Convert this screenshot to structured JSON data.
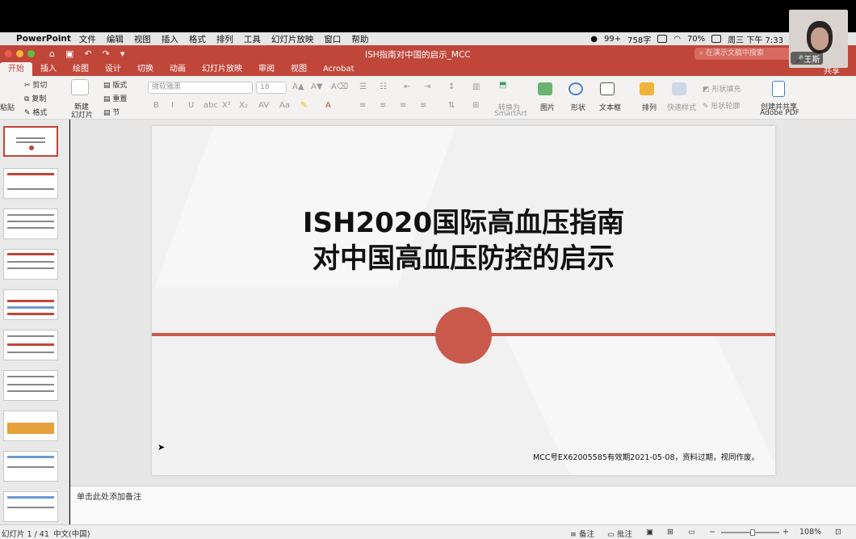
{
  "menubar": {
    "app": "PowerPoint",
    "items": [
      "文件",
      "编辑",
      "视图",
      "插入",
      "格式",
      "排列",
      "工具",
      "幻灯片放映",
      "窗口",
      "帮助"
    ],
    "wechat_badge": "99+",
    "word_count": "758字",
    "battery": "70%",
    "datetime": "周三 下午 7:33"
  },
  "titlebar": {
    "doc_title": "ISH指南对中国的启示_MCC",
    "search_placeholder": "在演示文稿中搜索",
    "share": "共享"
  },
  "tabs": [
    "开始",
    "插入",
    "绘图",
    "设计",
    "切换",
    "动画",
    "幻灯片放映",
    "审阅",
    "视图",
    "Acrobat"
  ],
  "ribbon": {
    "paste": "粘贴",
    "cut": "剪切",
    "copy": "复制",
    "format": "格式",
    "new_slide_1": "新建",
    "new_slide_2": "幻灯片",
    "layout": "版式",
    "reset": "重置",
    "section": "节",
    "font_placeholder": "微软雅黑",
    "font_size": "18",
    "convert_1": "转换为",
    "convert_2": "SmartArt",
    "picture": "图片",
    "shape": "形状",
    "textbox": "文本框",
    "arrange": "排列",
    "quick_styles": "快速样式",
    "shape_fill": "形状填充",
    "shape_outline": "形状轮廓",
    "create_pdf_1": "创建并共享",
    "create_pdf_2": "Adobe PDF"
  },
  "slide": {
    "title_line1": "ISH2020国际高血压指南",
    "title_line2": "对中国高血压防控的启示",
    "footer": "MCC号EX62005585有效期2021-05-08，资料过期，视同作废。"
  },
  "notes_placeholder": "单击此处添加备注",
  "status": {
    "slide_count": "幻灯片 1 / 41",
    "language": "中文(中国)",
    "notes_btn": "备注",
    "comments_btn": "批注",
    "zoom": "108%"
  },
  "webcam": {
    "name": "王斯"
  },
  "colors": {
    "accent": "#c0463a",
    "slide_red": "#c9594b"
  }
}
